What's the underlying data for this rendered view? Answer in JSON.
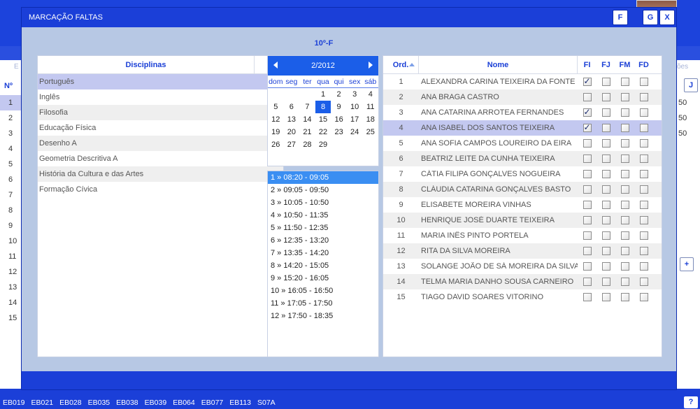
{
  "background": {
    "num_header": "Nº",
    "row_numbers": [
      "1",
      "2",
      "3",
      "4",
      "5",
      "6",
      "7",
      "8",
      "9",
      "10",
      "11",
      "12",
      "13",
      "14",
      "15"
    ],
    "left_label": "E",
    "right_label": "ões",
    "right_values": [
      "50",
      "50",
      "50"
    ],
    "j_button": "J",
    "plus_button": "+"
  },
  "bottom_bar": {
    "items": [
      "EB019",
      "EB021",
      "EB028",
      "EB035",
      "EB038",
      "EB039",
      "EB064",
      "EB077",
      "EB113",
      "S07A"
    ],
    "help": "?"
  },
  "modal": {
    "title": "MARCAÇÃO FALTAS",
    "btn_f": "F",
    "btn_g": "G",
    "btn_x": "X",
    "class_name": "10º-F"
  },
  "disciplinas": {
    "header": "Disciplinas",
    "items": [
      "Português",
      "Inglês",
      "Filosofia",
      "Educação Física",
      "Desenho A",
      "Geometria Descritiva A",
      "História da Cultura e das Artes",
      "Formação Cívica"
    ],
    "selected_index": 0
  },
  "calendar": {
    "month_label": "2/2012",
    "weekdays": [
      "dom",
      "seg",
      "ter",
      "qua",
      "qui",
      "sex",
      "sáb"
    ],
    "weeks": [
      [
        "",
        "",
        "",
        "1",
        "2",
        "3",
        "4"
      ],
      [
        "5",
        "6",
        "7",
        "8",
        "9",
        "10",
        "11"
      ],
      [
        "12",
        "13",
        "14",
        "15",
        "16",
        "17",
        "18"
      ],
      [
        "19",
        "20",
        "21",
        "22",
        "23",
        "24",
        "25"
      ],
      [
        "26",
        "27",
        "28",
        "29",
        "",
        "",
        ""
      ]
    ],
    "selected_day": "8"
  },
  "slots": {
    "items": [
      "1 » 08:20 - 09:05",
      "2 » 09:05 - 09:50",
      "3 » 10:05 - 10:50",
      "4 » 10:50 - 11:35",
      "5 » 11:50 - 12:35",
      "6 » 12:35 - 13:20",
      "7 » 13:35 - 14:20",
      "8 » 14:20 - 15:05",
      "9 » 15:20 - 16:05",
      "10 » 16:05 - 16:50",
      "11 » 17:05 - 17:50",
      "12 » 17:50 - 18:35"
    ],
    "selected_index": 0
  },
  "students": {
    "headers": {
      "ord": "Ord.",
      "nome": "Nome",
      "fi": "FI",
      "fj": "FJ",
      "fm": "FM",
      "fd": "FD"
    },
    "selected_index": 3,
    "rows": [
      {
        "ord": "1",
        "name": "ALEXANDRA CARINA TEIXEIRA DA FONTE",
        "fi": true,
        "fj": false,
        "fm": false,
        "fd": false
      },
      {
        "ord": "2",
        "name": "ANA BRAGA CASTRO",
        "fi": false,
        "fj": false,
        "fm": false,
        "fd": false
      },
      {
        "ord": "3",
        "name": "ANA CATARINA ARROTEA FERNANDES",
        "fi": true,
        "fj": false,
        "fm": false,
        "fd": false
      },
      {
        "ord": "4",
        "name": "ANA ISABEL DOS SANTOS TEIXEIRA",
        "fi": true,
        "fj": false,
        "fm": false,
        "fd": false
      },
      {
        "ord": "5",
        "name": "ANA SOFIA CAMPOS LOUREIRO DA EIRA",
        "fi": false,
        "fj": false,
        "fm": false,
        "fd": false
      },
      {
        "ord": "6",
        "name": "BEATRIZ LEITE DA CUNHA TEIXEIRA",
        "fi": false,
        "fj": false,
        "fm": false,
        "fd": false
      },
      {
        "ord": "7",
        "name": "CÁTIA FILIPA GONÇALVES NOGUEIRA",
        "fi": false,
        "fj": false,
        "fm": false,
        "fd": false
      },
      {
        "ord": "8",
        "name": "CLÁUDIA CATARINA GONÇALVES BASTO",
        "fi": false,
        "fj": false,
        "fm": false,
        "fd": false
      },
      {
        "ord": "9",
        "name": "ELISABETE MOREIRA VINHAS",
        "fi": false,
        "fj": false,
        "fm": false,
        "fd": false
      },
      {
        "ord": "10",
        "name": "HENRIQUE JOSÉ DUARTE TEIXEIRA",
        "fi": false,
        "fj": false,
        "fm": false,
        "fd": false
      },
      {
        "ord": "11",
        "name": "MARIA INÊS PINTO PORTELA",
        "fi": false,
        "fj": false,
        "fm": false,
        "fd": false
      },
      {
        "ord": "12",
        "name": "RITA DA SILVA MOREIRA",
        "fi": false,
        "fj": false,
        "fm": false,
        "fd": false
      },
      {
        "ord": "13",
        "name": "SOLANGE JOÃO DE SÁ MOREIRA DA SILVA",
        "fi": false,
        "fj": false,
        "fm": false,
        "fd": false
      },
      {
        "ord": "14",
        "name": "TELMA MARIA DANHO SOUSA CARNEIRO",
        "fi": false,
        "fj": false,
        "fm": false,
        "fd": false
      },
      {
        "ord": "15",
        "name": "TIAGO DAVID SOARES VITORINO",
        "fi": false,
        "fj": false,
        "fm": false,
        "fd": false
      }
    ]
  }
}
